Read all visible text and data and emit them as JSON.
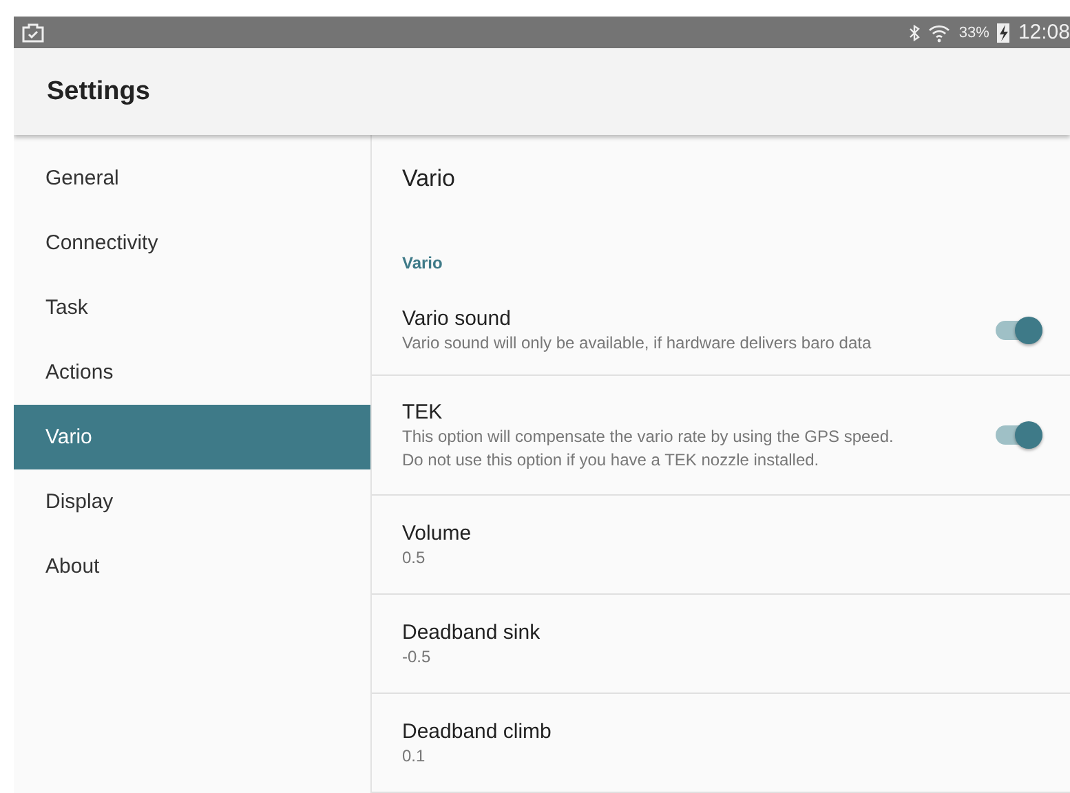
{
  "status_bar": {
    "battery": "33%",
    "time": "12:08"
  },
  "app_bar": {
    "title": "Settings"
  },
  "sidebar": {
    "items": [
      {
        "label": "General",
        "selected": false
      },
      {
        "label": "Connectivity",
        "selected": false
      },
      {
        "label": "Task",
        "selected": false
      },
      {
        "label": "Actions",
        "selected": false
      },
      {
        "label": "Vario",
        "selected": true
      },
      {
        "label": "Display",
        "selected": false
      },
      {
        "label": "About",
        "selected": false
      }
    ]
  },
  "panel": {
    "title": "Vario",
    "section": "Vario",
    "rows": [
      {
        "kind": "switch",
        "title": "Vario sound",
        "summary": [
          "Vario sound will only be available, if hardware delivers baro data"
        ],
        "on": true
      },
      {
        "kind": "switch",
        "title": "TEK",
        "summary": [
          "This option will compensate the vario rate by using the GPS speed.",
          "Do not use this option if you have a TEK nozzle installed."
        ],
        "on": true
      },
      {
        "kind": "value",
        "title": "Volume",
        "summary": [
          "0.5"
        ]
      },
      {
        "kind": "value",
        "title": "Deadband sink",
        "summary": [
          "-0.5"
        ]
      },
      {
        "kind": "value",
        "title": "Deadband climb",
        "summary": [
          "0.1"
        ]
      }
    ]
  }
}
